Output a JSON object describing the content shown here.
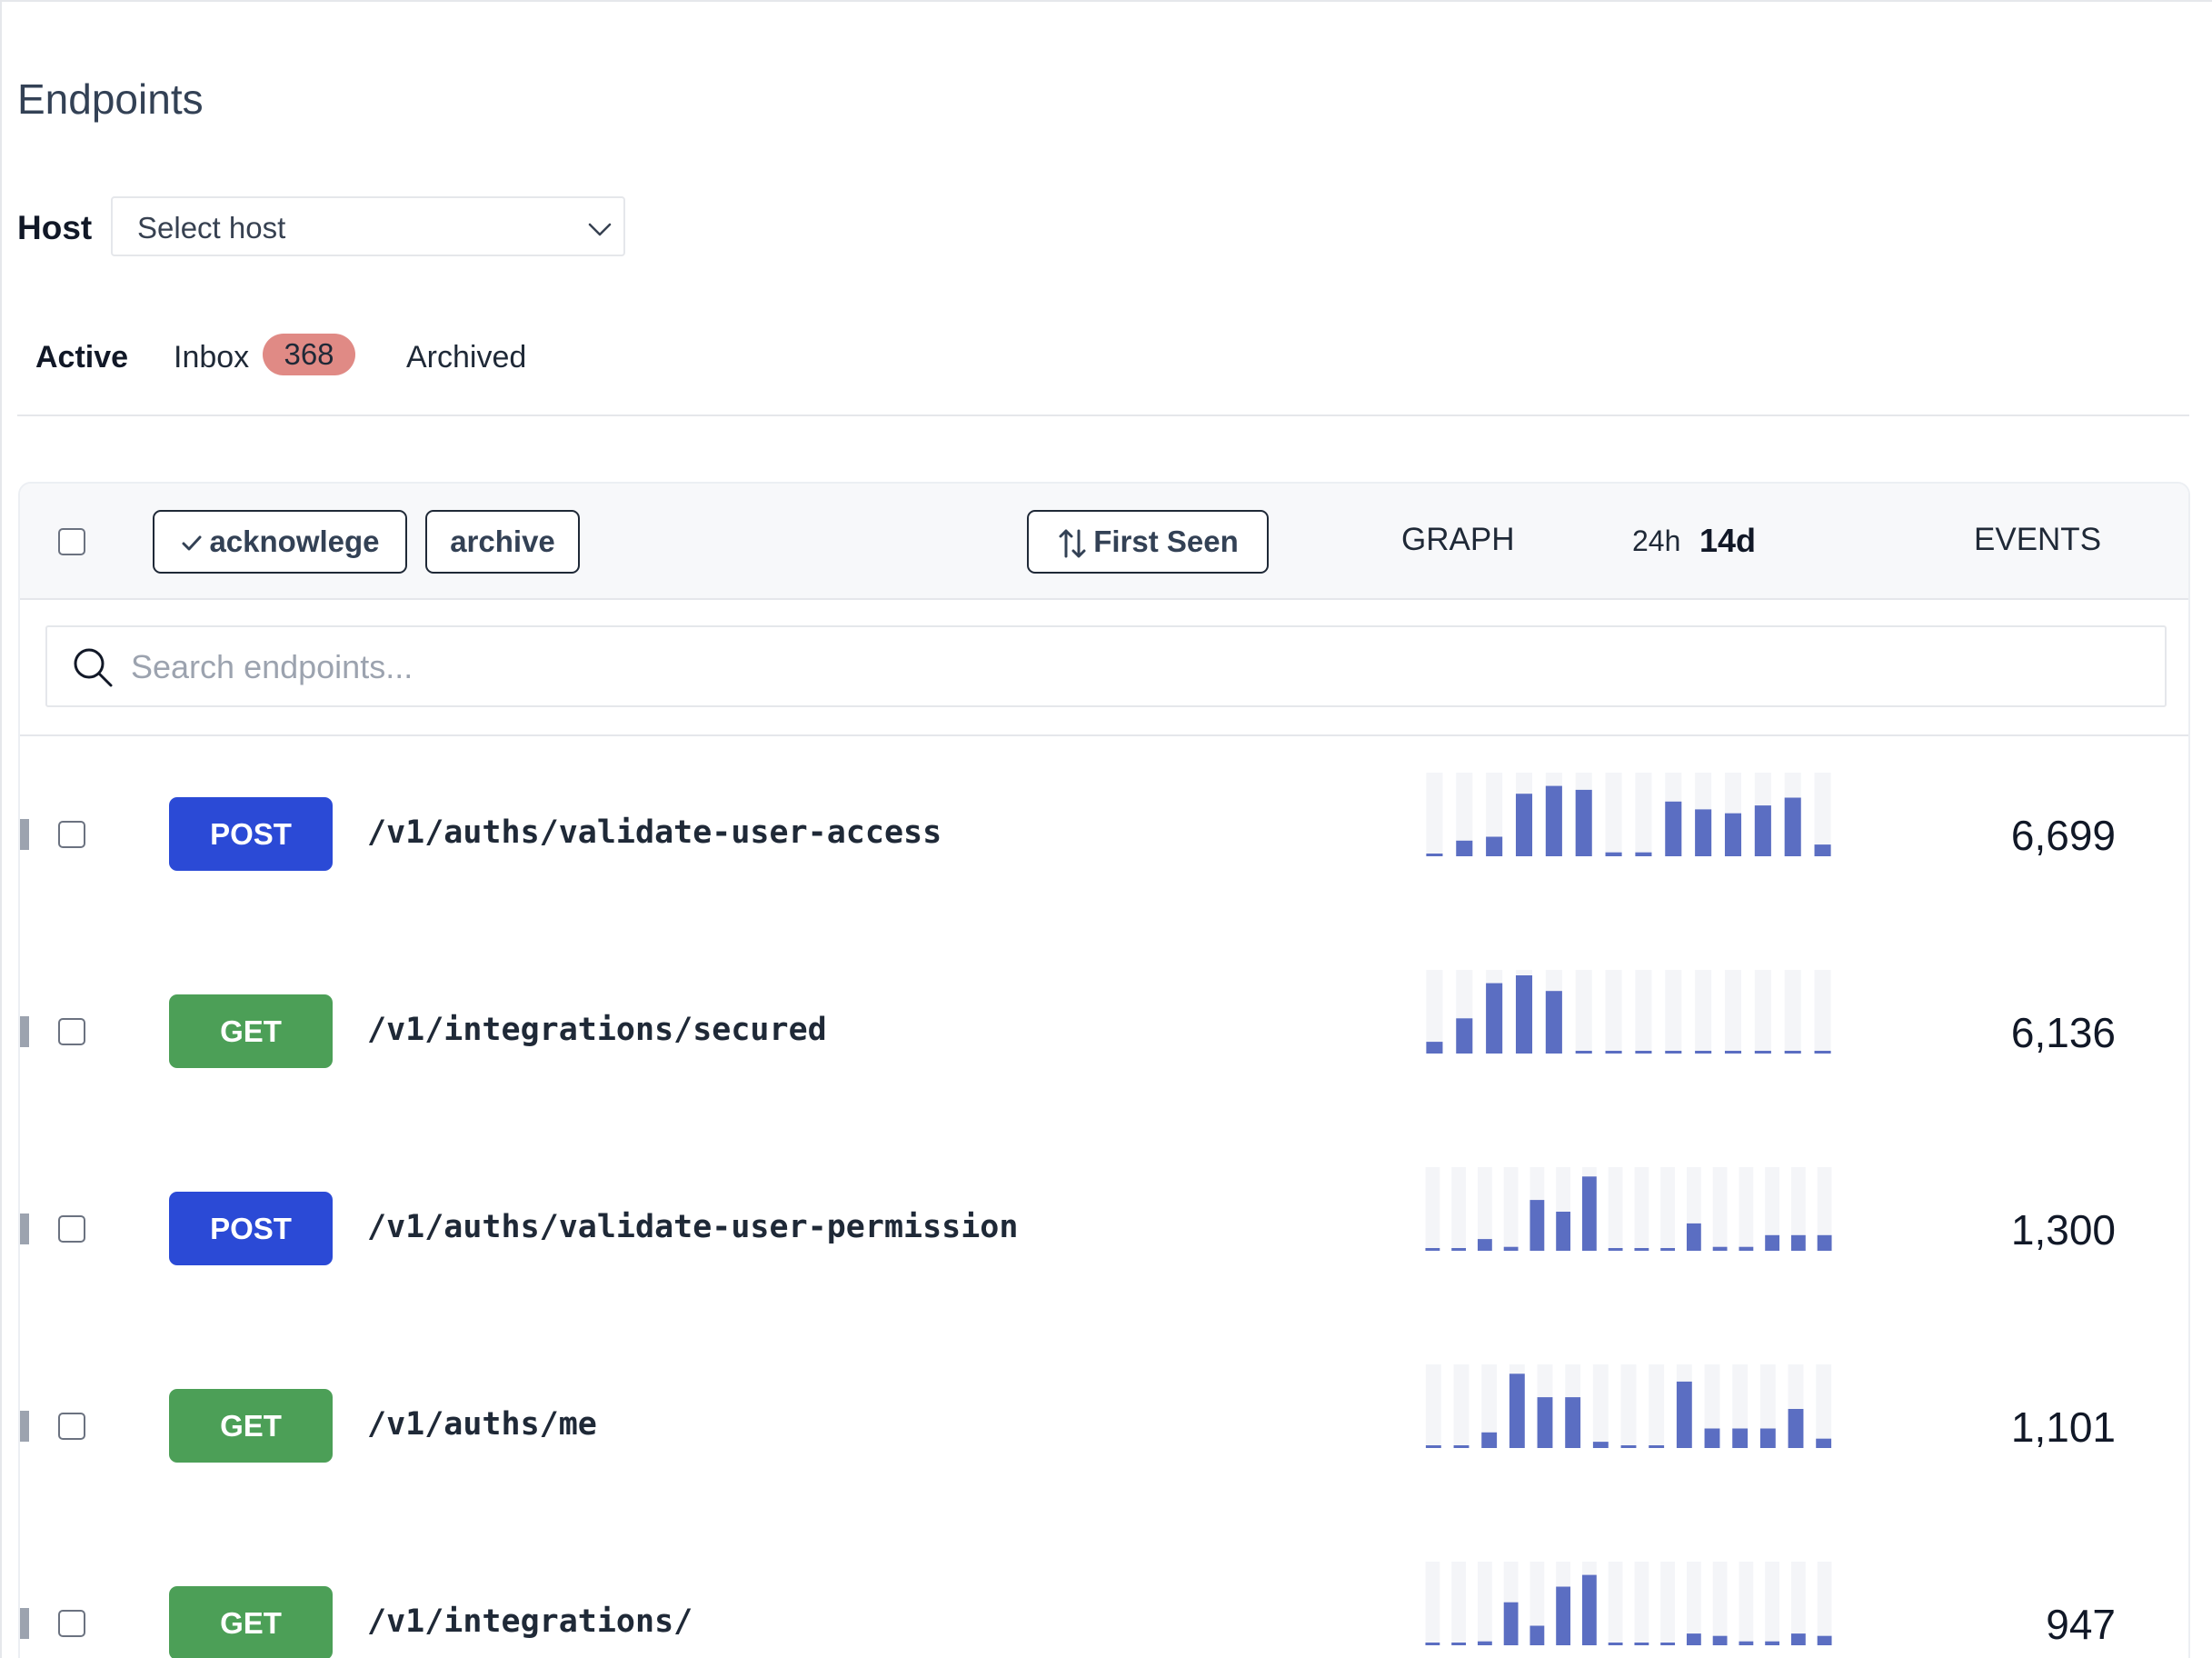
{
  "page": {
    "title": "Endpoints"
  },
  "host": {
    "label": "Host",
    "placeholder": "Select host"
  },
  "tabs": [
    {
      "label": "Active",
      "active": true
    },
    {
      "label": "Inbox",
      "badge": "368",
      "badge_color": "#e08a85"
    },
    {
      "label": "Archived"
    }
  ],
  "toolbar": {
    "acknowledge_label": "acknowlege",
    "archive_label": "archive",
    "sort_label": "First Seen",
    "graph_header": "GRAPH",
    "range_short": "24h",
    "range_long": "14d",
    "events_header": "EVENTS"
  },
  "search": {
    "placeholder": "Search endpoints..."
  },
  "colors": {
    "POST": "#2b4ad6",
    "GET": "#4c9f57",
    "spark_bar": "#5b6ec2",
    "spark_bg": "#f4f5f8"
  },
  "rows": [
    {
      "method": "POST",
      "path": "/v1/auths/validate-user-access",
      "events": "6,699",
      "spark": [
        0,
        0.2,
        0.25,
        0.8,
        0.9,
        0.85,
        0.05,
        0.05,
        0.7,
        0.6,
        0.55,
        0.65,
        0.75,
        0.15
      ]
    },
    {
      "method": "GET",
      "path": "/v1/integrations/secured",
      "events": "6,136",
      "spark": [
        0.15,
        0.45,
        0.9,
        1.0,
        0.8,
        0,
        0,
        0,
        0,
        0,
        0,
        0,
        0,
        0
      ]
    },
    {
      "method": "POST",
      "path": "/v1/auths/validate-user-permission",
      "events": "1,300",
      "spark": [
        0,
        0,
        0.15,
        0.05,
        0.65,
        0.5,
        0.95,
        0,
        0,
        0,
        0.35,
        0.05,
        0.05,
        0.2,
        0.2,
        0.2
      ]
    },
    {
      "method": "GET",
      "path": "/v1/auths/me",
      "events": "1,101",
      "spark": [
        0,
        0,
        0.2,
        0.95,
        0.65,
        0.65,
        0.08,
        0,
        0,
        0.85,
        0.25,
        0.25,
        0.25,
        0.5,
        0.12
      ]
    },
    {
      "method": "GET",
      "path": "/v1/integrations/",
      "events": "947",
      "spark": [
        0,
        0,
        0.05,
        0.55,
        0.25,
        0.75,
        0.9,
        0,
        0,
        0,
        0.15,
        0.12,
        0.05,
        0.05,
        0.15,
        0.12
      ]
    }
  ]
}
